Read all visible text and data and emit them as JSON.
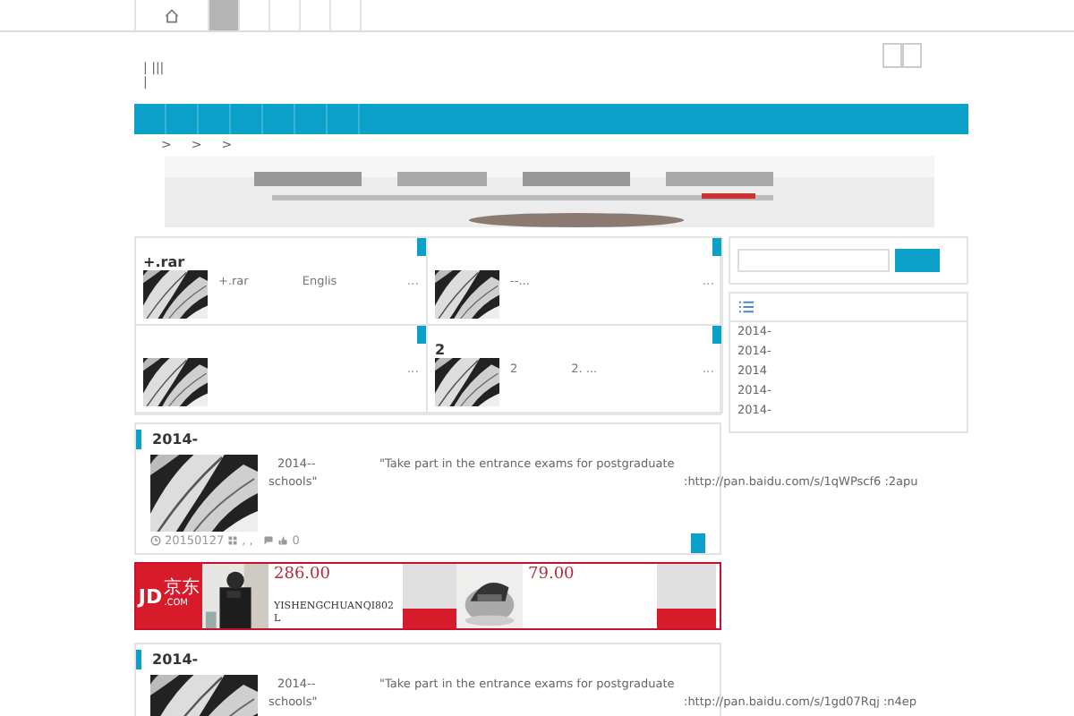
{
  "top_nav": {
    "tabs": [
      {
        "kind": "home",
        "selected": false
      },
      {
        "kind": "blank",
        "selected": true
      },
      {
        "kind": "blank",
        "selected": false
      },
      {
        "kind": "blank",
        "selected": false
      },
      {
        "kind": "blank",
        "selected": false
      },
      {
        "kind": "blank",
        "selected": false
      }
    ]
  },
  "header": {
    "lines": [
      "| |||",
      "|"
    ]
  },
  "breadcrumb": [
    ">",
    ">",
    ">"
  ],
  "banner": {
    "kind": "picture"
  },
  "grid": [
    {
      "title": "+.rar",
      "texts": [
        "+.rar",
        "Englis"
      ],
      "more": "..."
    },
    {
      "texts": [
        "--..."
      ],
      "more": "..."
    },
    {
      "more": "..."
    },
    {
      "title": "2",
      "texts": [
        "2",
        "2. ..."
      ],
      "more": "..."
    }
  ],
  "posts": [
    {
      "title": "2014-",
      "lead": "2014--",
      "quote": "\"Take part in the entrance exams for postgraduate",
      "tail": "schools\"",
      "link": ":http://pan.baidu.com/s/1qWPscf6 :2apu",
      "date": "20150127",
      "tags": ", ,",
      "likes": "0"
    },
    {
      "title": "2014-",
      "lead": "2014--",
      "quote": "\"Take part in the entrance exams for postgraduate",
      "tail": "schools\"",
      "link": ":http://pan.baidu.com/s/1gd07Rqj :n4ep"
    }
  ],
  "ad": {
    "logo": "JD",
    "logo_sub": ".COM",
    "brand": "京东",
    "products": [
      {
        "price": "286.00",
        "name": "YISHENGCHUANQI802 L"
      },
      {
        "price": "79.00"
      }
    ]
  },
  "sidebar": {
    "list": [
      "2014-",
      "2014-",
      "2014",
      "2014-",
      "2014-"
    ]
  }
}
